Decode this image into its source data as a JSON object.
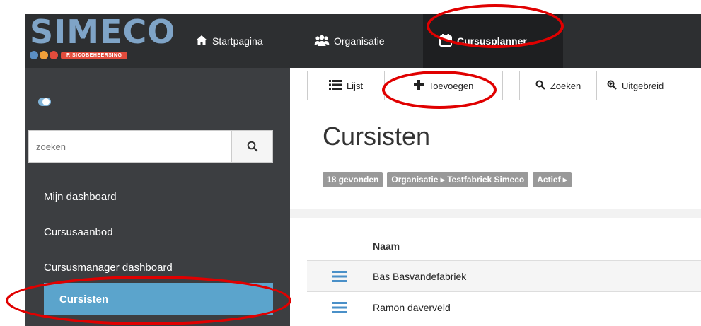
{
  "brand": {
    "name": "SIMECO",
    "tagline": "RISICOBEHEERSING",
    "dot_colors": [
      "#5b8fc4",
      "#f1a13a",
      "#e34c3c"
    ]
  },
  "topnav": {
    "items": [
      {
        "label": "Startpagina",
        "icon": "home-icon"
      },
      {
        "label": "Organisatie",
        "icon": "users-icon"
      },
      {
        "label": "Cursusplanner",
        "icon": "calendar-icon",
        "active": true
      }
    ]
  },
  "sidebar": {
    "search_placeholder": "zoeken",
    "items": [
      {
        "label": "Mijn dashboard"
      },
      {
        "label": "Cursusaanbod"
      },
      {
        "label": "Cursusmanager dashboard"
      },
      {
        "label": "Cursisten",
        "active": true
      }
    ]
  },
  "toolbar": {
    "buttons": [
      {
        "label": "Lijst",
        "icon": "list-icon"
      },
      {
        "label": "Toevoegen",
        "icon": "plus-icon"
      },
      {
        "label": "Zoeken",
        "icon": "search-icon"
      },
      {
        "label": "Uitgebreid",
        "icon": "zoom-icon"
      }
    ]
  },
  "main": {
    "title": "Cursisten",
    "badges": [
      "18 gevonden",
      "Organisatie ▸ Testfabriek Simeco",
      "Actief ▸"
    ],
    "table": {
      "column_header": "Naam",
      "rows": [
        "Bas Basvandefabriek",
        "Ramon daverveld"
      ]
    }
  },
  "colors": {
    "nav_bg": "#2d2f31",
    "sidebar_bg": "#3c3e41",
    "active_blue": "#5ba4cc",
    "annotation_red": "#e00000"
  }
}
